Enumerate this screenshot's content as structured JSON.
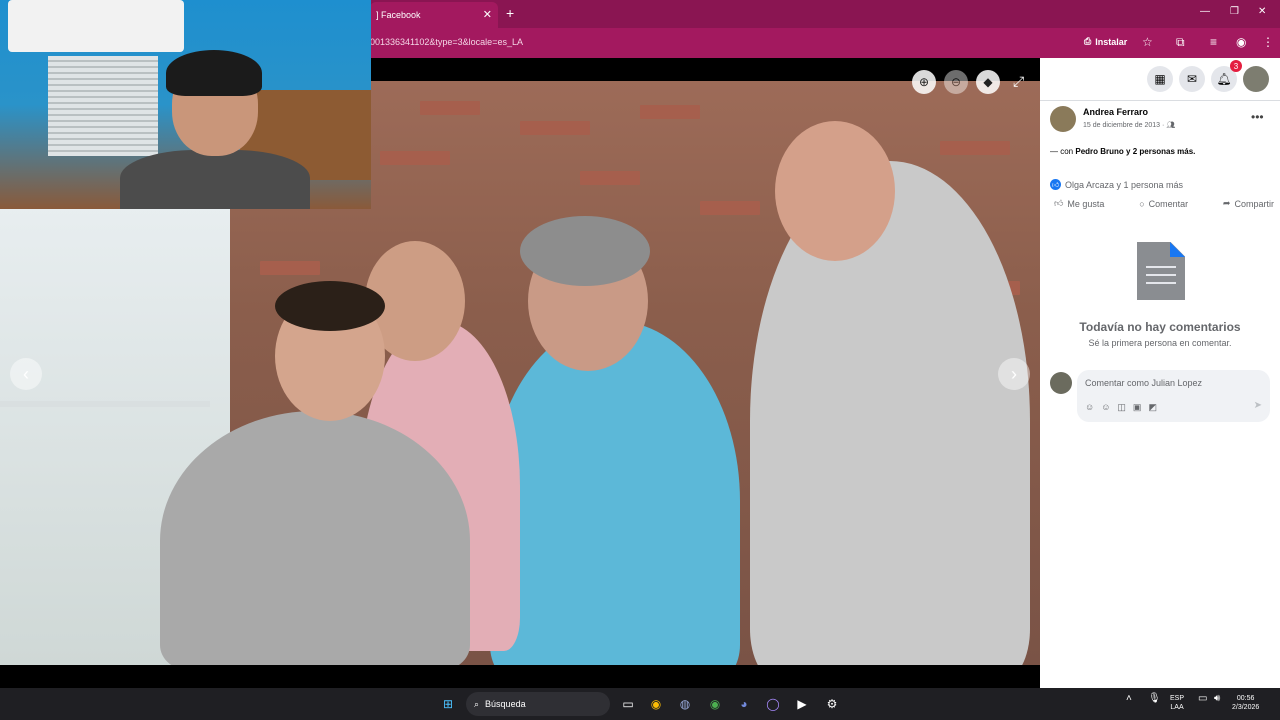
{
  "browser": {
    "tab_title": "Facebook",
    "tab_prefix": "]",
    "url": "001336341102&type=3&locale=es_LA",
    "install_label": "Instalar"
  },
  "viewer": {
    "tools": [
      "zoom-in-icon",
      "zoom-out-icon",
      "tag-icon"
    ],
    "prev_arrow": "‹",
    "next_arrow": "›"
  },
  "post": {
    "author": "Andrea Ferraro",
    "date": "15 de diciembre de 2013 ·",
    "with_prefix": "— con",
    "with_names": "Pedro Bruno y 2 personas más.",
    "reactions": "Olga Arcaza y 1 persona más",
    "actions": {
      "like": "Me gusta",
      "comment": "Comentar",
      "share": "Compartir"
    },
    "no_comments_title": "Todavía no hay comentarios",
    "no_comments_sub": "Sé la primera persona en comentar.",
    "comment_placeholder": "Comentar como Julian Lopez"
  },
  "panel_top": {
    "notification_count": "3"
  },
  "taskbar": {
    "search_label": "Búsqueda",
    "lang_top": "ESP",
    "lang_bottom": "LAA",
    "time": "00:56",
    "date": "2/3/2026"
  },
  "colors": {
    "chrome": "#8a1552",
    "facebook_blue": "#1877f2"
  }
}
